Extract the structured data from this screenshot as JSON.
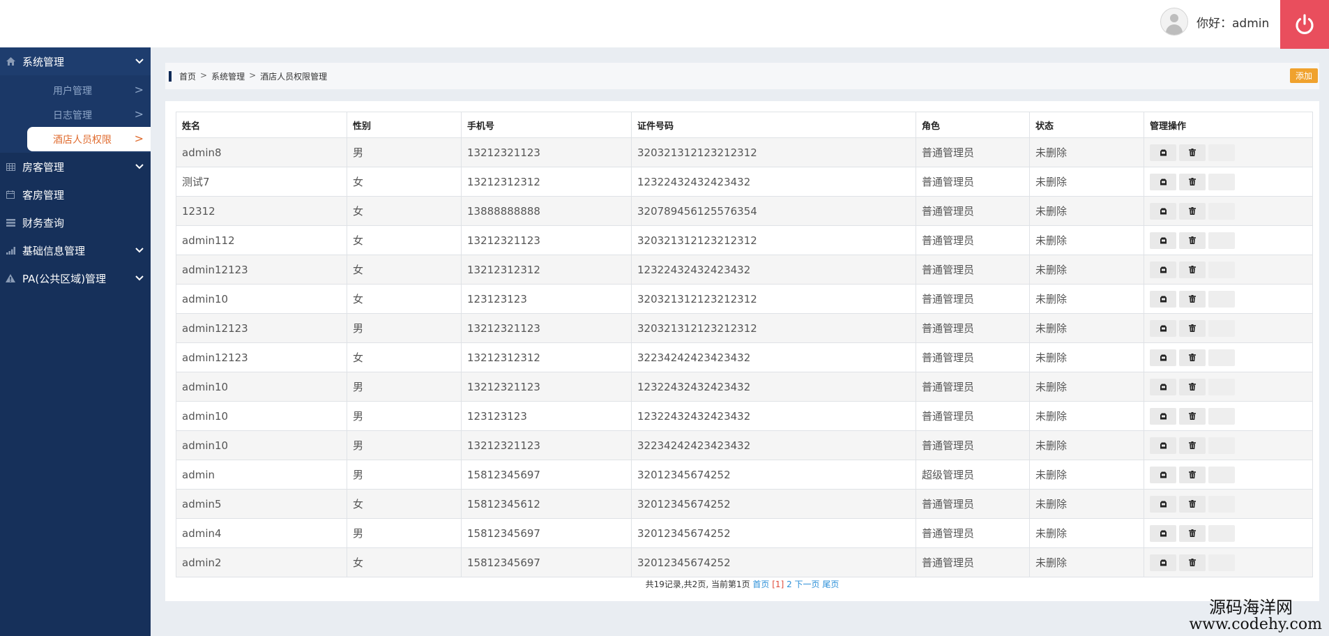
{
  "header": {
    "greeting": "你好：admin"
  },
  "sidebar": {
    "items": [
      {
        "label": "系统管理",
        "icon": "home-icon",
        "expanded": true
      },
      {
        "label": "房客管理",
        "icon": "grid-icon",
        "expanded": false
      },
      {
        "label": "客房管理",
        "icon": "calendar-icon",
        "expanded": false
      },
      {
        "label": "财务查询",
        "icon": "list-icon",
        "expanded": false
      },
      {
        "label": "基础信息管理",
        "icon": "signal-icon",
        "expanded": false
      },
      {
        "label": "PA(公共区域)管理",
        "icon": "warning-icon",
        "expanded": false
      }
    ],
    "subitems": [
      {
        "label": "用户管理",
        "arrow": ">"
      },
      {
        "label": "日志管理",
        "arrow": ">"
      },
      {
        "label": "酒店人员权限",
        "arrow": ">",
        "active": true
      }
    ]
  },
  "breadcrumb": {
    "items": [
      "首页",
      "系统管理",
      "酒店人员权限管理"
    ],
    "separator": ">"
  },
  "toolbar": {
    "add_label": "添加"
  },
  "table": {
    "headers": [
      "姓名",
      "性别",
      "手机号",
      "证件号码",
      "角色",
      "状态",
      "管理操作"
    ],
    "rows": [
      [
        "admin8",
        "男",
        "13212321123",
        "320321312123212312",
        "普通管理员",
        "未删除"
      ],
      [
        "测试7",
        "女",
        "13212312312",
        "12322432432423432",
        "普通管理员",
        "未删除"
      ],
      [
        "12312",
        "女",
        "13888888888",
        "320789456125576354",
        "普通管理员",
        "未删除"
      ],
      [
        "admin112",
        "女",
        "13212321123",
        "320321312123212312",
        "普通管理员",
        "未删除"
      ],
      [
        "admin12123",
        "女",
        "13212312312",
        "12322432432423432",
        "普通管理员",
        "未删除"
      ],
      [
        "admin10",
        "女",
        "123123123",
        "320321312123212312",
        "普通管理员",
        "未删除"
      ],
      [
        "admin12123",
        "男",
        "13212321123",
        "320321312123212312",
        "普通管理员",
        "未删除"
      ],
      [
        "admin12123",
        "女",
        "13212312312",
        "32234242423423432",
        "普通管理员",
        "未删除"
      ],
      [
        "admin10",
        "男",
        "13212321123",
        "12322432432423432",
        "普通管理员",
        "未删除"
      ],
      [
        "admin10",
        "男",
        "123123123",
        "12322432432423432",
        "普通管理员",
        "未删除"
      ],
      [
        "admin10",
        "男",
        "13212321123",
        "32234242423423432",
        "普通管理员",
        "未删除"
      ],
      [
        "admin",
        "男",
        "15812345697",
        "32012345674252",
        "超级管理员",
        "未删除"
      ],
      [
        "admin5",
        "女",
        "15812345612",
        "32012345674252",
        "普通管理员",
        "未删除"
      ],
      [
        "admin4",
        "男",
        "15812345697",
        "32012345674252",
        "普通管理员",
        "未删除"
      ],
      [
        "admin2",
        "女",
        "15812345697",
        "32012345674252",
        "普通管理员",
        "未删除"
      ]
    ],
    "row_actions": [
      {
        "icon": "edit-icon"
      },
      {
        "icon": "trash-icon"
      },
      {
        "icon": "blank"
      }
    ]
  },
  "pagination": {
    "summary": "共19记录,共2页, 当前第1页",
    "first": "首页",
    "current": "[1]",
    "page2": "2",
    "next": "下一页",
    "last": "尾页"
  },
  "watermark": {
    "cn": "源码海洋网",
    "en": "www.codehy.com"
  },
  "colors": {
    "sidebar_bg": "#16305a",
    "power_button": "#e94e5d",
    "add_button": "#f0a22e",
    "active_subitem_text": "#e06b2e",
    "link": "#2b8fd8"
  }
}
